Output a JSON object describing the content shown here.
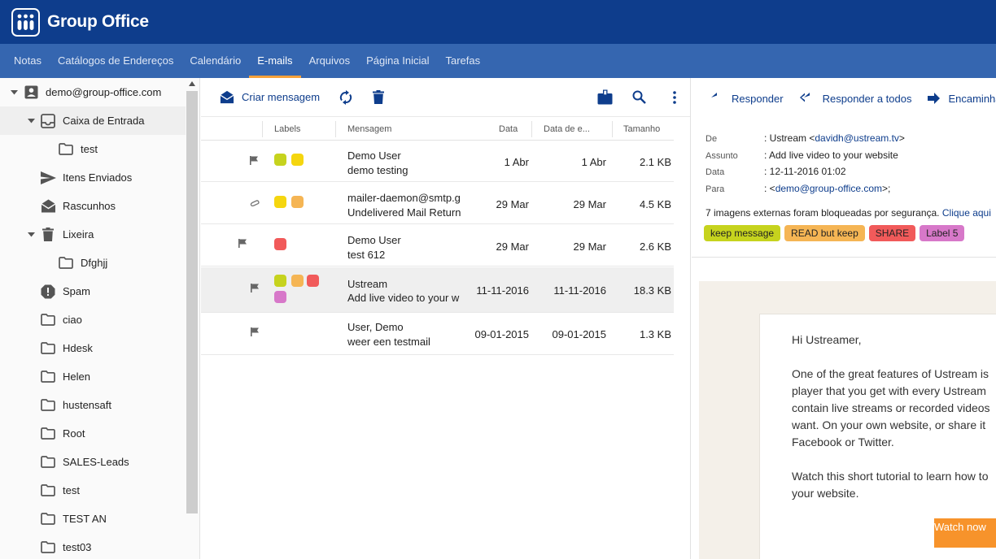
{
  "app": {
    "title": "Group Office"
  },
  "nav": {
    "tabs": [
      "Notas",
      "Catálogos de Endereços",
      "Calendário",
      "E-mails",
      "Arquivos",
      "Página Inicial",
      "Tarefas"
    ],
    "active": "E-mails"
  },
  "sidebar": {
    "account": "demo@group-office.com",
    "folders": [
      {
        "label": "Caixa de Entrada",
        "icon": "inbox-icon"
      },
      {
        "label": "test",
        "icon": "folder-icon"
      },
      {
        "label": "Itens Enviados",
        "icon": "send-icon"
      },
      {
        "label": "Rascunhos",
        "icon": "drafts-icon"
      },
      {
        "label": "Lixeira",
        "icon": "trash-icon"
      },
      {
        "label": "Dfghjj",
        "icon": "folder-icon"
      },
      {
        "label": "Spam",
        "icon": "spam-icon"
      },
      {
        "label": "ciao",
        "icon": "folder-icon"
      },
      {
        "label": "Hdesk",
        "icon": "folder-icon"
      },
      {
        "label": "Helen",
        "icon": "folder-icon"
      },
      {
        "label": "hustensaft",
        "icon": "folder-icon"
      },
      {
        "label": "Root",
        "icon": "folder-icon"
      },
      {
        "label": "SALES-Leads",
        "icon": "folder-icon"
      },
      {
        "label": "test",
        "icon": "folder-icon"
      },
      {
        "label": "TEST AN",
        "icon": "folder-icon"
      },
      {
        "label": "test03",
        "icon": "folder-icon"
      }
    ]
  },
  "list": {
    "compose_label": "Criar mensagem",
    "columns": {
      "labels": "Labels",
      "message": "Mensagem",
      "date": "Data",
      "date2": "Data de e...",
      "size": "Tamanho"
    },
    "rows": [
      {
        "from": "Demo User",
        "subject": "demo testing",
        "date": "1 Abr",
        "date2": "1 Abr",
        "size": "2.1 KB",
        "icon": "flag-icon",
        "labels": [
          "#c6d31e",
          "#f5d60f"
        ]
      },
      {
        "from": "mailer-daemon@smtp.g",
        "subject": "Undelivered Mail Return",
        "date": "29 Mar",
        "date2": "29 Mar",
        "size": "4.5 KB",
        "icon": "paperclip-icon",
        "labels": [
          "#f5d60f",
          "#f5b554"
        ]
      },
      {
        "from": "Demo User",
        "subject": "test 612",
        "date": "29 Mar",
        "date2": "29 Mar",
        "size": "2.6 KB",
        "icon": "flag-icon",
        "labels": [
          "#f15a5a"
        ]
      },
      {
        "from": "Ustream",
        "subject": "Add live video to your w",
        "date": "11-11-2016",
        "date2": "11-11-2016",
        "size": "18.3 KB",
        "icon": "flag-icon",
        "labels": [
          "#c6d31e",
          "#f5b554",
          "#f15a5a",
          "#d778c9"
        ]
      },
      {
        "from": "User, Demo",
        "subject": "weer een testmail",
        "date": "09-01-2015",
        "date2": "09-01-2015",
        "size": "1.3 KB",
        "icon": "flag-icon",
        "labels": []
      }
    ]
  },
  "detail": {
    "actions": {
      "reply": "Responder",
      "reply_all": "Responder a todos",
      "forward": "Encaminhar"
    },
    "headers": {
      "from_k": "De",
      "from_name": ": Ustream <",
      "from_email": "davidh@ustream.tv",
      "from_close": ">",
      "subject_k": "Assunto",
      "subject": ": Add live video to your website",
      "date_k": "Data",
      "date": ": 12-11-2016 01:02",
      "to_k": "Para",
      "to_open": ": <",
      "to_email": "demo@group-office.com",
      "to_close": ">;"
    },
    "blocked_text": "7 imagens externas foram bloqueadas por segurança.",
    "blocked_link": "Clique aqui",
    "tags": [
      {
        "label": "keep message",
        "color": "#c6d31e"
      },
      {
        "label": "READ but keep",
        "color": "#f5b554"
      },
      {
        "label": "SHARE",
        "color": "#f15a5a"
      },
      {
        "label": "Label 5",
        "color": "#d778c9"
      }
    ],
    "body": {
      "greeting": "Hi Ustreamer,",
      "p1": [
        "One of the great features of Ustream is",
        "player that you get with every Ustream",
        "contain live streams or recorded videos",
        "want. On your own website, or share it",
        "Facebook or Twitter."
      ],
      "p2": [
        "Watch this short tutorial to learn how to",
        "your website."
      ],
      "button": "Watch now"
    }
  },
  "colors": {
    "topbar": "#0e3d8c",
    "navbar": "#3566b0",
    "accent": "#f7a13a",
    "link": "#0e3d8c"
  }
}
